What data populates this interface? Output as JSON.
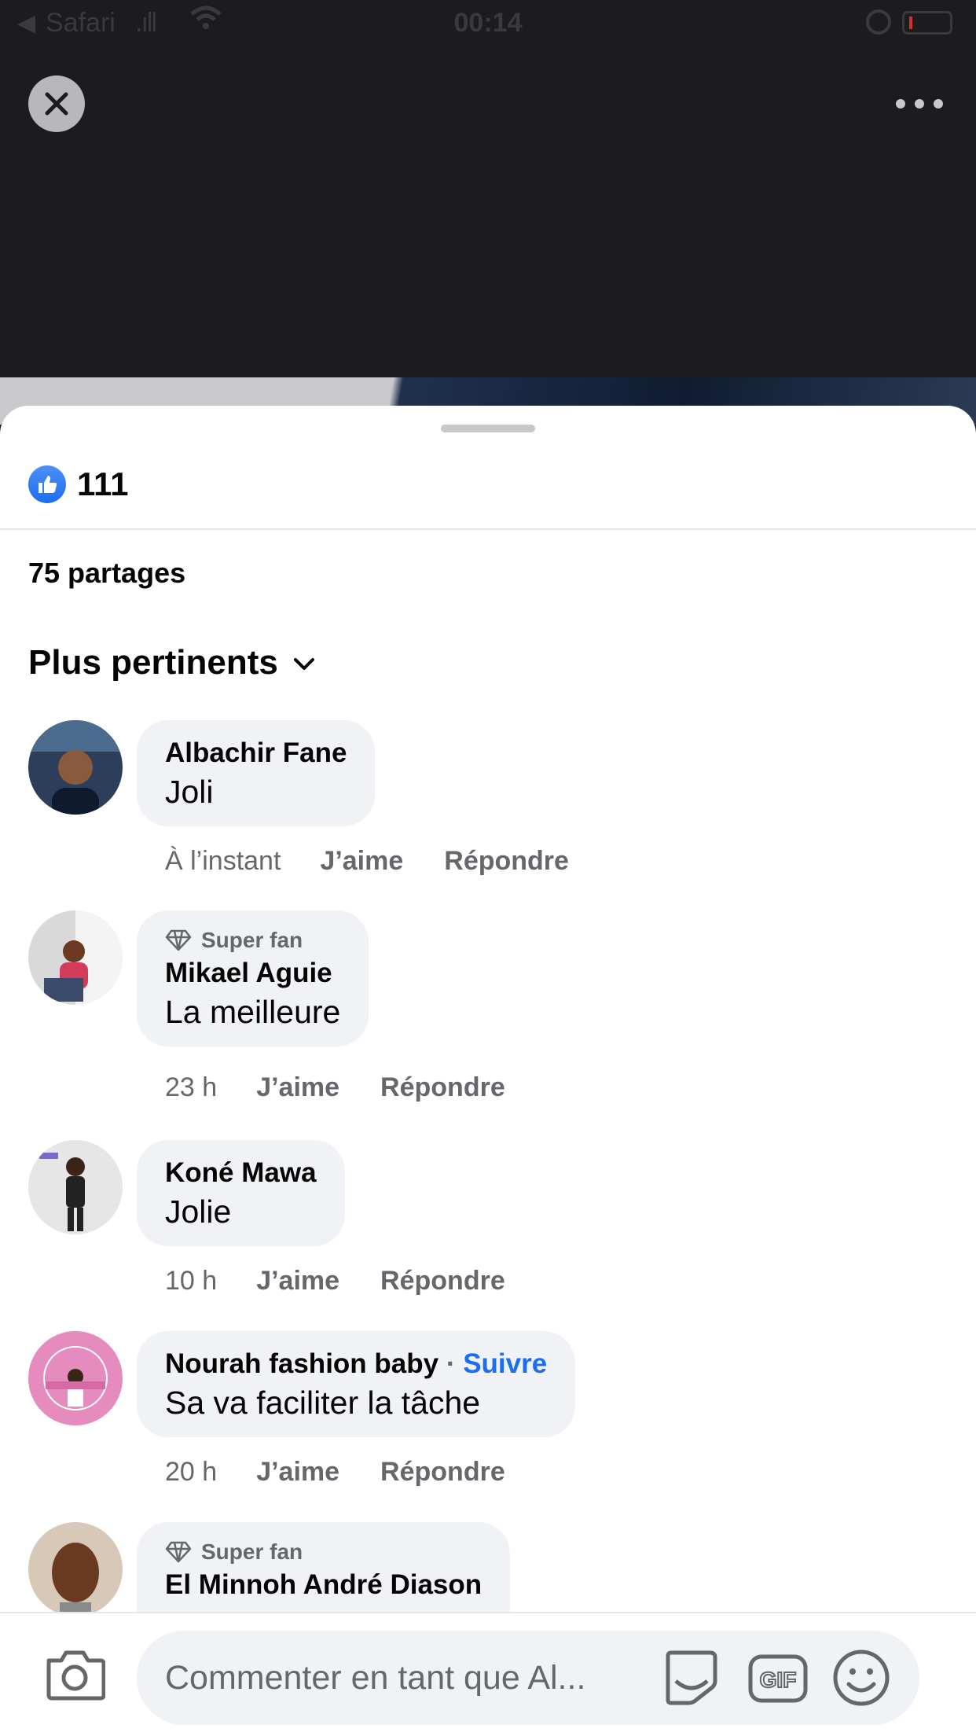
{
  "status_bar": {
    "back_glyph": "◀",
    "carrier": "Safari",
    "time": "00:14"
  },
  "post": {
    "reactions_count": "111",
    "shares": "75 partages",
    "sort_label": "Plus pertinents"
  },
  "comments": [
    {
      "name": "Albachir Fane",
      "text": "Joli",
      "time": "À l’instant",
      "like": "J’aime",
      "reply": "Répondre",
      "avatar_colors": [
        "#2c3e5a",
        "#8a5a3c"
      ]
    },
    {
      "badge": "Super fan",
      "name": "Mikael Aguie",
      "text": "La meilleure",
      "time": "23 h",
      "like": "J’aime",
      "reply": "Répondre",
      "avatar_colors": [
        "#d9d9d9",
        "#d23c5a"
      ]
    },
    {
      "name": "Koné Mawa",
      "text": "Jolie",
      "time": "10 h",
      "like": "J’aime",
      "reply": "Répondre",
      "avatar_colors": [
        "#e6e6e6",
        "#222222"
      ]
    },
    {
      "name": "Nourah fashion baby",
      "follow_sep": " · ",
      "follow": "Suivre",
      "text": "Sa va faciliter la tâche",
      "time": "20 h",
      "like": "J’aime",
      "reply": "Répondre",
      "avatar_colors": [
        "#e58bbd",
        "#ffffff"
      ]
    },
    {
      "badge": "Super fan",
      "name": "El Minnoh André Diason",
      "avatar_colors": [
        "#d8c8b8",
        "#6b3a22"
      ]
    }
  ],
  "composer": {
    "placeholder": "Commenter en tant que Al...",
    "gif_label": "GIF"
  },
  "colors": {
    "accent": "#1b6ef3",
    "bubble": "#f0f2f5",
    "secondary_text": "#65676b"
  },
  "icons": [
    "close-icon",
    "more-icon",
    "like-icon",
    "chevron-down-icon",
    "diamond-icon",
    "camera-icon",
    "sticker-icon",
    "gif-icon",
    "emoji-icon"
  ]
}
